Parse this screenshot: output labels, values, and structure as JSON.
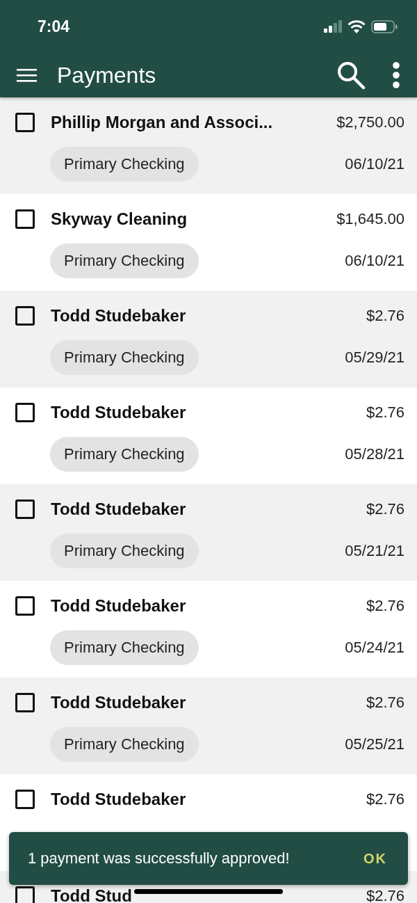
{
  "status_bar": {
    "time": "7:04"
  },
  "app_bar": {
    "title": "Payments"
  },
  "payments": [
    {
      "payee": "Phillip Morgan and Associ...",
      "amount": "$2,750.00",
      "account": "Primary Checking",
      "date": "06/10/21",
      "checked": false
    },
    {
      "payee": "Skyway Cleaning",
      "amount": "$1,645.00",
      "account": "Primary Checking",
      "date": "06/10/21",
      "checked": false
    },
    {
      "payee": "Todd Studebaker",
      "amount": "$2.76",
      "account": "Primary Checking",
      "date": "05/29/21",
      "checked": false
    },
    {
      "payee": "Todd Studebaker",
      "amount": "$2.76",
      "account": "Primary Checking",
      "date": "05/28/21",
      "checked": false
    },
    {
      "payee": "Todd Studebaker",
      "amount": "$2.76",
      "account": "Primary Checking",
      "date": "05/21/21",
      "checked": false
    },
    {
      "payee": "Todd Studebaker",
      "amount": "$2.76",
      "account": "Primary Checking",
      "date": "05/24/21",
      "checked": false
    },
    {
      "payee": "Todd Studebaker",
      "amount": "$2.76",
      "account": "Primary Checking",
      "date": "05/25/21",
      "checked": false
    },
    {
      "payee": "Todd Studebaker",
      "amount": "$2.76",
      "checked": false
    },
    {
      "payee": "Todd Stud",
      "amount": "$2.76",
      "checked": false
    }
  ],
  "snackbar": {
    "message": "1 payment was successfully approved!",
    "action": "OK"
  }
}
